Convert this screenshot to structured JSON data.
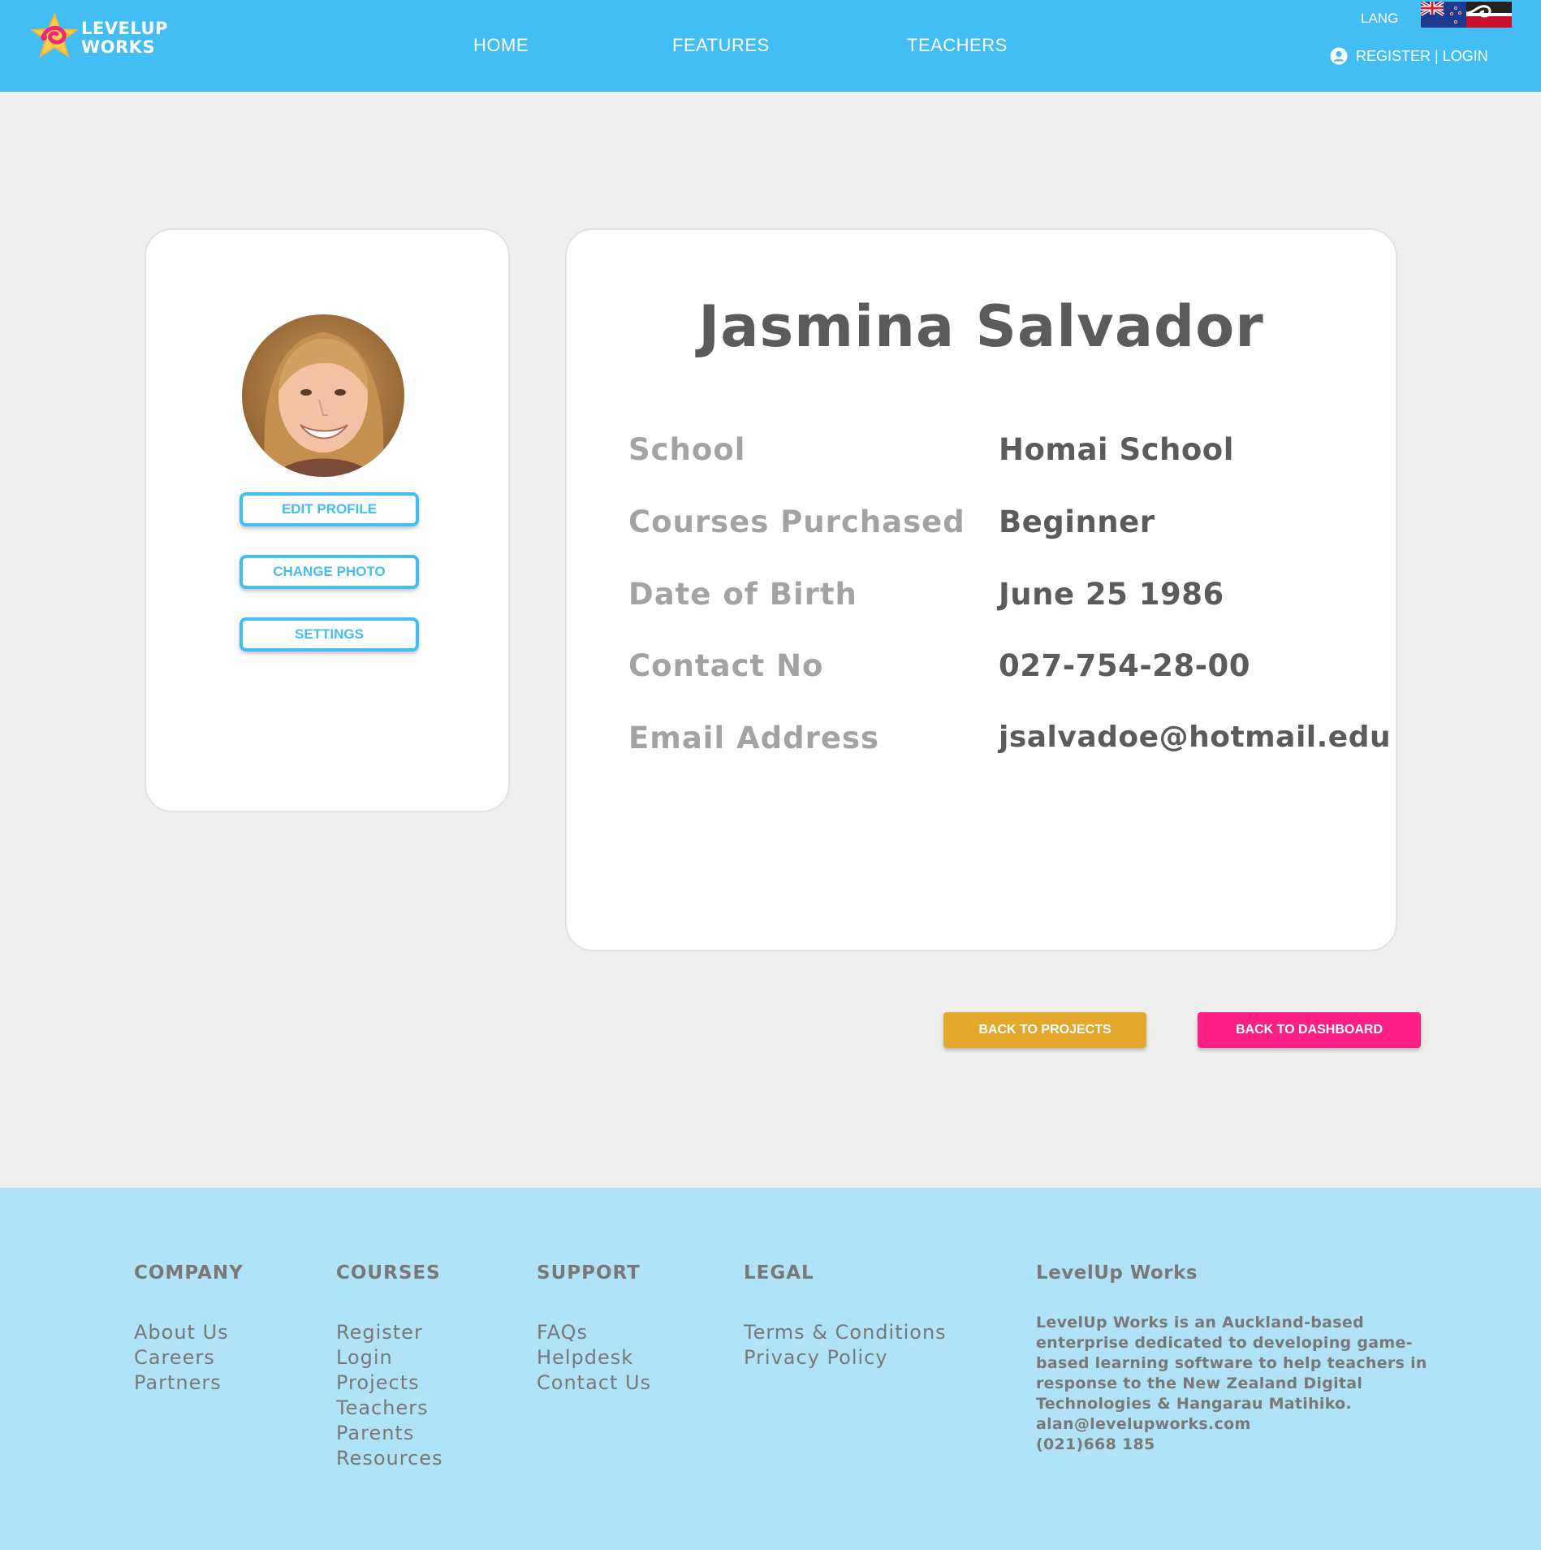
{
  "header": {
    "logo_line1": "LEVELUP",
    "logo_line2": "WORKS",
    "nav": [
      {
        "label": "HOME"
      },
      {
        "label": "FEATURES"
      },
      {
        "label": "TEACHERS"
      }
    ],
    "lang_label": "LANG",
    "auth_label": "REGISTER | LOGIN"
  },
  "sidebar": {
    "buttons": [
      {
        "label": "EDIT PROFILE"
      },
      {
        "label": "CHANGE PHOTO"
      },
      {
        "label": "SETTINGS"
      }
    ]
  },
  "profile": {
    "name": "Jasmina Salvador",
    "fields": [
      {
        "label": "School",
        "value": "Homai School"
      },
      {
        "label": "Courses Purchased",
        "value": "Beginner"
      },
      {
        "label": "Date of Birth",
        "value": "June 25 1986"
      },
      {
        "label": "Contact No",
        "value": "027-754-28-00"
      },
      {
        "label": "Email Address",
        "value": "jsalvadoe@hotmail.edu"
      }
    ]
  },
  "actions": {
    "back_projects": "BACK TO PROJECTS",
    "back_dashboard": "BACK TO DASHBOARD"
  },
  "footer": {
    "company": {
      "heading": "COMPANY",
      "links": [
        "About Us",
        "Careers",
        "Partners"
      ]
    },
    "courses": {
      "heading": "COURSES",
      "links": [
        "Register",
        "Login",
        "Projects",
        "Teachers",
        "Parents",
        "Resources"
      ]
    },
    "support": {
      "heading": "SUPPORT",
      "links": [
        "FAQs",
        "Helpdesk",
        "Contact Us"
      ]
    },
    "legal": {
      "heading": "LEGAL",
      "links": [
        "Terms & Conditions",
        "Privacy Policy"
      ]
    },
    "about": {
      "heading": "LevelUp Works",
      "lines": [
        "LevelUp Works is an Auckland-based",
        "enterprise dedicated to developing game-",
        "based learning software to help teachers in",
        "response to the New Zealand Digital",
        "Technologies & Hangarau Matihiko.",
        "alan@levelupworks.com",
        "(021)668 185"
      ]
    }
  },
  "colors": {
    "header": "#43bef4",
    "footer": "#b1e3f8",
    "page": "#efefef",
    "accent_yellow": "#e4a82c",
    "accent_pink": "#fd1f83"
  },
  "icons": {
    "logo": "star-swirl-logo-icon",
    "user": "user-circle-icon",
    "flag_nz": "nz-flag-icon",
    "flag_maori": "tino-rangatiratanga-flag-icon"
  }
}
